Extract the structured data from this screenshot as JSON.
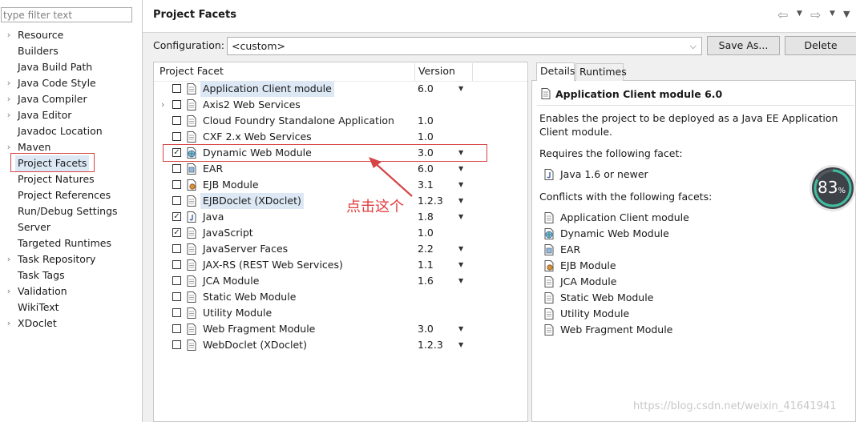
{
  "sidebar": {
    "filter_placeholder": "type filter text",
    "items": [
      {
        "label": "Resource",
        "expandable": true
      },
      {
        "label": "Builders",
        "expandable": false
      },
      {
        "label": "Java Build Path",
        "expandable": false
      },
      {
        "label": "Java Code Style",
        "expandable": true
      },
      {
        "label": "Java Compiler",
        "expandable": true
      },
      {
        "label": "Java Editor",
        "expandable": true
      },
      {
        "label": "Javadoc Location",
        "expandable": false
      },
      {
        "label": "Maven",
        "expandable": true
      },
      {
        "label": "Project Facets",
        "expandable": false,
        "selected": true
      },
      {
        "label": "Project Natures",
        "expandable": false
      },
      {
        "label": "Project References",
        "expandable": false
      },
      {
        "label": "Run/Debug Settings",
        "expandable": false
      },
      {
        "label": "Server",
        "expandable": false
      },
      {
        "label": "Targeted Runtimes",
        "expandable": false
      },
      {
        "label": "Task Repository",
        "expandable": true
      },
      {
        "label": "Task Tags",
        "expandable": false
      },
      {
        "label": "Validation",
        "expandable": true
      },
      {
        "label": "WikiText",
        "expandable": false
      },
      {
        "label": "XDoclet",
        "expandable": true
      }
    ]
  },
  "header": {
    "title": "Project Facets"
  },
  "configuration": {
    "label": "Configuration:",
    "value": "<custom>",
    "save_as_label": "Save As...",
    "delete_label": "Delete"
  },
  "facets_table": {
    "col_facet": "Project Facet",
    "col_version": "Version",
    "rows": [
      {
        "name": "Application Client module",
        "version": "6.0",
        "checked": false,
        "dropdown": true,
        "icon": "page-icon",
        "highlight": true,
        "expandable": false
      },
      {
        "name": "Axis2 Web Services",
        "version": "",
        "checked": false,
        "dropdown": false,
        "icon": "page-icon",
        "highlight": false,
        "expandable": true
      },
      {
        "name": "Cloud Foundry Standalone Application",
        "version": "1.0",
        "checked": false,
        "dropdown": false,
        "icon": "page-icon",
        "highlight": false,
        "expandable": false
      },
      {
        "name": "CXF 2.x Web Services",
        "version": "1.0",
        "checked": false,
        "dropdown": false,
        "icon": "page-icon",
        "highlight": false,
        "expandable": false
      },
      {
        "name": "Dynamic Web Module",
        "version": "3.0",
        "checked": true,
        "dropdown": true,
        "icon": "globe-icon",
        "highlight": false,
        "expandable": false
      },
      {
        "name": "EAR",
        "version": "6.0",
        "checked": false,
        "dropdown": true,
        "icon": "ear-icon",
        "highlight": false,
        "expandable": false
      },
      {
        "name": "EJB Module",
        "version": "3.1",
        "checked": false,
        "dropdown": true,
        "icon": "ejb-icon",
        "highlight": false,
        "expandable": false
      },
      {
        "name": "EJBDoclet (XDoclet)",
        "version": "1.2.3",
        "checked": false,
        "dropdown": true,
        "icon": "page-icon",
        "highlight": true,
        "expandable": false
      },
      {
        "name": "Java",
        "version": "1.8",
        "checked": true,
        "dropdown": true,
        "icon": "java-icon",
        "highlight": false,
        "expandable": false
      },
      {
        "name": "JavaScript",
        "version": "1.0",
        "checked": true,
        "dropdown": false,
        "icon": "page-icon",
        "highlight": false,
        "expandable": false
      },
      {
        "name": "JavaServer Faces",
        "version": "2.2",
        "checked": false,
        "dropdown": true,
        "icon": "page-icon",
        "highlight": false,
        "expandable": false
      },
      {
        "name": "JAX-RS (REST Web Services)",
        "version": "1.1",
        "checked": false,
        "dropdown": true,
        "icon": "page-icon",
        "highlight": false,
        "expandable": false
      },
      {
        "name": "JCA Module",
        "version": "1.6",
        "checked": false,
        "dropdown": true,
        "icon": "page-icon",
        "highlight": false,
        "expandable": false
      },
      {
        "name": "Static Web Module",
        "version": "",
        "checked": false,
        "dropdown": false,
        "icon": "page-icon",
        "highlight": false,
        "expandable": false
      },
      {
        "name": "Utility Module",
        "version": "",
        "checked": false,
        "dropdown": false,
        "icon": "page-icon",
        "highlight": false,
        "expandable": false
      },
      {
        "name": "Web Fragment Module",
        "version": "3.0",
        "checked": false,
        "dropdown": true,
        "icon": "page-icon",
        "highlight": false,
        "expandable": false
      },
      {
        "name": "WebDoclet (XDoclet)",
        "version": "1.2.3",
        "checked": false,
        "dropdown": true,
        "icon": "page-icon",
        "highlight": false,
        "expandable": false
      }
    ]
  },
  "details": {
    "tab_details": "Details",
    "tab_runtimes": "Runtimes",
    "title": "Application Client module 6.0",
    "description": "Enables the project to be deployed as a Java EE Application Client module.",
    "requires_label": "Requires the following facet:",
    "requires_item": "Java 1.6 or newer",
    "conflicts_label": "Conflicts with the following facets:",
    "conflicts": [
      {
        "label": "Application Client module",
        "icon": "page-icon"
      },
      {
        "label": "Dynamic Web Module",
        "icon": "globe-icon"
      },
      {
        "label": "EAR",
        "icon": "ear-icon"
      },
      {
        "label": "EJB Module",
        "icon": "ejb-icon"
      },
      {
        "label": "JCA Module",
        "icon": "page-icon"
      },
      {
        "label": "Static Web Module",
        "icon": "page-icon"
      },
      {
        "label": "Utility Module",
        "icon": "page-icon"
      },
      {
        "label": "Web Fragment Module",
        "icon": "page-icon"
      }
    ]
  },
  "annotation": {
    "text": "点击这个"
  },
  "perf_widget": {
    "value": "83",
    "unit": "%",
    "fraction": 0.83
  },
  "watermark": "https://blog.csdn.net/weixin_41641941",
  "colors": {
    "annotation_red": "#d64545",
    "selection": "#dde8f5",
    "widget_ring": "#3fbfa0"
  }
}
